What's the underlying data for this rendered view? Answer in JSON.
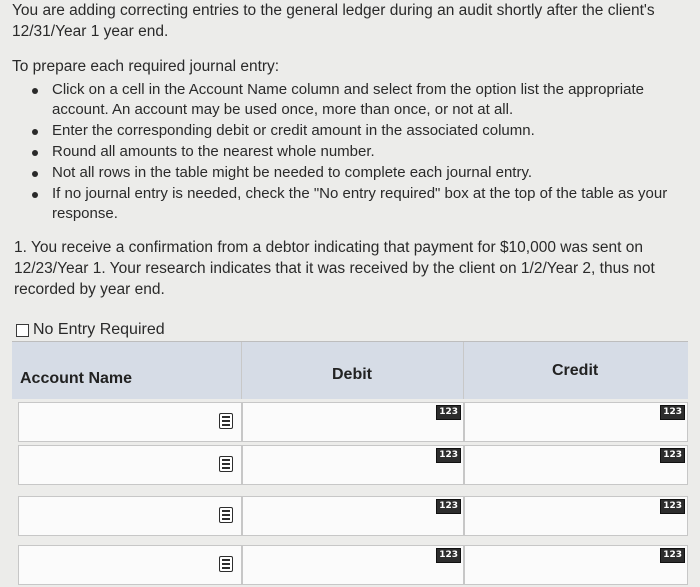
{
  "intro": "You are adding correcting entries to the general ledger during an audit shortly after the client's 12/31/Year 1 year end.",
  "instructions_title": "To prepare each required journal entry:",
  "instructions": [
    "Click on a cell in the Account Name column and select from the option list the appropriate account. An account may be used once, more than once, or not at all.",
    "Enter the corresponding debit or credit amount in the associated column.",
    "Round all amounts to the nearest whole number.",
    "Not all rows in the table might be needed to complete each journal entry.",
    "If no journal entry is needed, check the \"No entry required\" box at the top of the table as your response."
  ],
  "question": "1. You receive a confirmation from a debtor indicating that payment for $10,000 was sent on 12/23/Year 1. Your research indicates that it was received by the client on 1/2/Year 2, thus not recorded by year end.",
  "no_entry_label": "No Entry Required",
  "no_entry_checked": false,
  "table": {
    "headers": {
      "account": "Account Name",
      "debit": "Debit",
      "credit": "Credit"
    },
    "number_badge": "123",
    "rows": [
      {
        "account": "",
        "debit": "",
        "credit": ""
      },
      {
        "account": "",
        "debit": "",
        "credit": ""
      },
      {
        "account": "",
        "debit": "",
        "credit": ""
      },
      {
        "account": "",
        "debit": "",
        "credit": ""
      }
    ]
  },
  "colors": {
    "header_bg": "#d6dce6",
    "page_bg": "#ececea"
  }
}
